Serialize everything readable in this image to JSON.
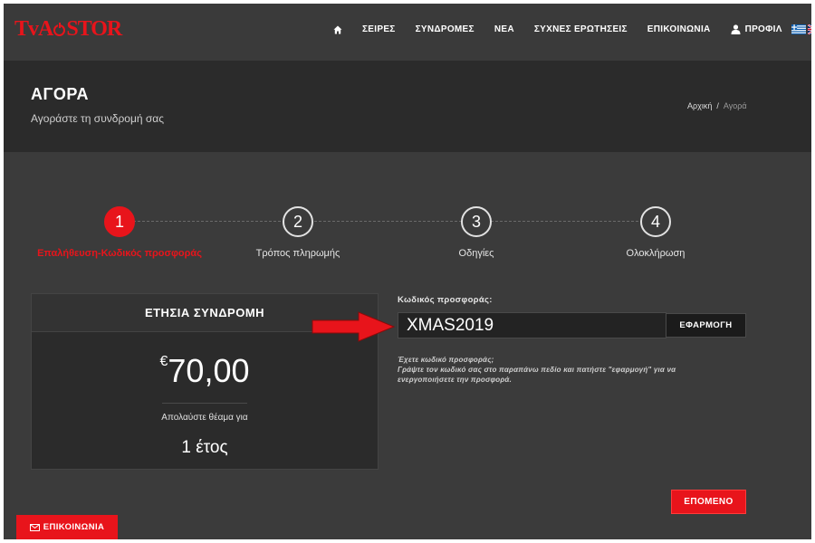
{
  "brand": {
    "logo_left": "TvA",
    "logo_right": "STOR",
    "accent": "#e8141b"
  },
  "nav": {
    "items": [
      "ΣΕΙΡΕΣ",
      "ΣΥΝΔΡΟΜΕΣ",
      "ΝΕΑ",
      "ΣΥΧΝΕΣ ΕΡΩΤΗΣΕΙΣ",
      "ΕΠΙΚΟΙΝΩΝΙΑ"
    ],
    "profile": "ΠΡΟΦΙΛ"
  },
  "page": {
    "title": "ΑΓΟΡΑ",
    "subtitle": "Αγοράστε τη συνδρομή σας"
  },
  "breadcrumb": {
    "home": "Αρχική",
    "separator": "/",
    "current": "Αγορά"
  },
  "steps": [
    {
      "number": "1",
      "label": "Επαλήθευση-Κωδικός προσφοράς",
      "active": true
    },
    {
      "number": "2",
      "label": "Τρόπος πληρωμής",
      "active": false
    },
    {
      "number": "3",
      "label": "Οδηγίες",
      "active": false
    },
    {
      "number": "4",
      "label": "Ολοκλήρωση",
      "active": false
    }
  ],
  "card": {
    "title": "ΕΤΗΣΙΑ ΣΥΝΔΡΟΜΗ",
    "currency": "€",
    "price": "70,00",
    "description": "Απολαύστε θέαμα για",
    "duration": "1 έτος"
  },
  "promo": {
    "label": "Κωδικός προσφοράς:",
    "value": "XMAS2019",
    "apply_label": "ΕΦΑΡΜΟΓΗ",
    "help_line1": "Έχετε κωδικό προσφοράς;",
    "help_line2": "Γράψτε τον κωδικό σας στο παραπάνω πεδίο και πατήστε \"εφαρμογή\" για να ενεργοποιήσετε την προσφορά."
  },
  "next_label": "ΕΠΟΜΕΝΟ",
  "contact_label": "ΕΠΙΚΟΙΝΩΝΙΑ"
}
